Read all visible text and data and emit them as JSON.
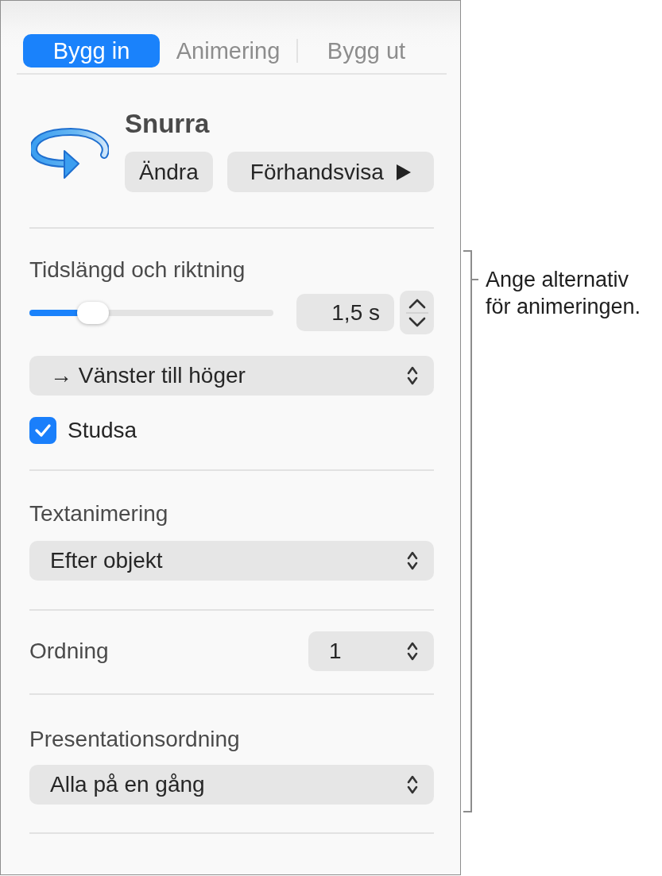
{
  "tabs": [
    {
      "label": "Bygg in",
      "selected": true
    },
    {
      "label": "Animering",
      "selected": false
    },
    {
      "label": "Bygg ut",
      "selected": false
    }
  ],
  "effect": {
    "title": "Snurra",
    "buttons": [
      {
        "label": "Ändra",
        "kind": "plain"
      },
      {
        "label": "Förhandsvisa",
        "kind": "play"
      }
    ]
  },
  "sections": [
    {
      "kind": "duration",
      "heading": "Tidslängd och riktning",
      "slider": {
        "level": 0.26
      },
      "duration": "1,5 s",
      "direction": "→ Vänster till höger",
      "checkbox": {
        "label": "Studsa",
        "checked": true
      }
    },
    {
      "kind": "popup",
      "heading": "Textanimering",
      "value": "Efter objekt"
    },
    {
      "kind": "inline_popup",
      "heading": "Ordning",
      "value": "1"
    },
    {
      "kind": "popup",
      "heading": "Presentationsordning",
      "value": "Alla på en gång"
    }
  ],
  "callout": {
    "lines": [
      "Ange alternativ",
      "för animeringen."
    ]
  }
}
